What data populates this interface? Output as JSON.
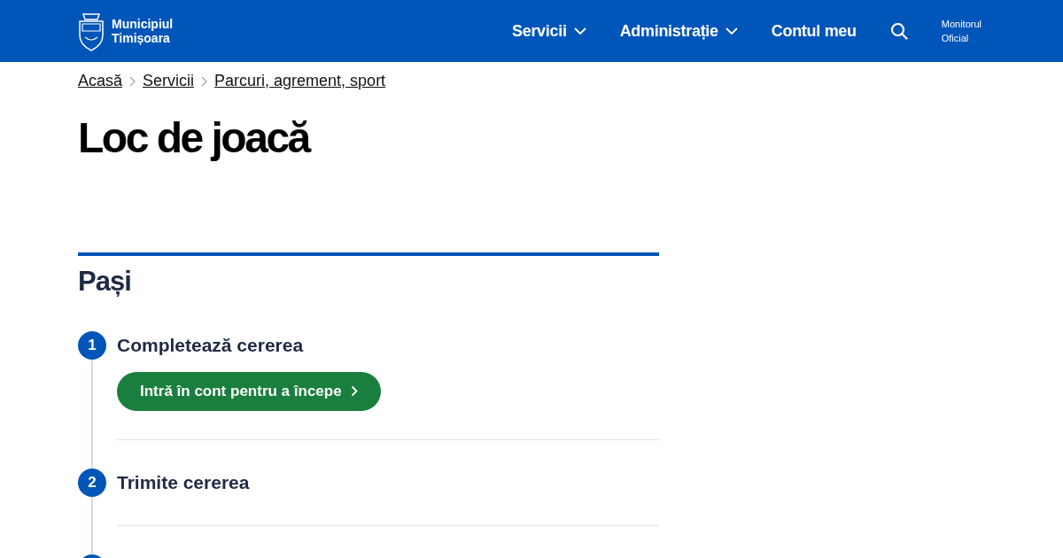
{
  "header": {
    "logo_text": [
      "Municipiul",
      "Timișoara"
    ],
    "nav": [
      {
        "label": "Servicii",
        "dropdown": true
      },
      {
        "label": "Administrație",
        "dropdown": true
      },
      {
        "label": "Contul meu",
        "dropdown": false
      }
    ],
    "extra_link": [
      "Monitorul",
      "Oficial"
    ]
  },
  "breadcrumb": [
    "Acasă",
    "Servicii",
    "Parcuri, agrement, sport"
  ],
  "title": "Loc de joacă",
  "steps_section": {
    "heading": "Pași",
    "steps": [
      {
        "kind": "step",
        "number": "1",
        "title": "Completează cererea",
        "button": "Intră în cont pentru a începe"
      },
      {
        "kind": "step",
        "number": "2",
        "title": "Trimite cererea"
      },
      {
        "kind": "cut"
      }
    ]
  }
}
